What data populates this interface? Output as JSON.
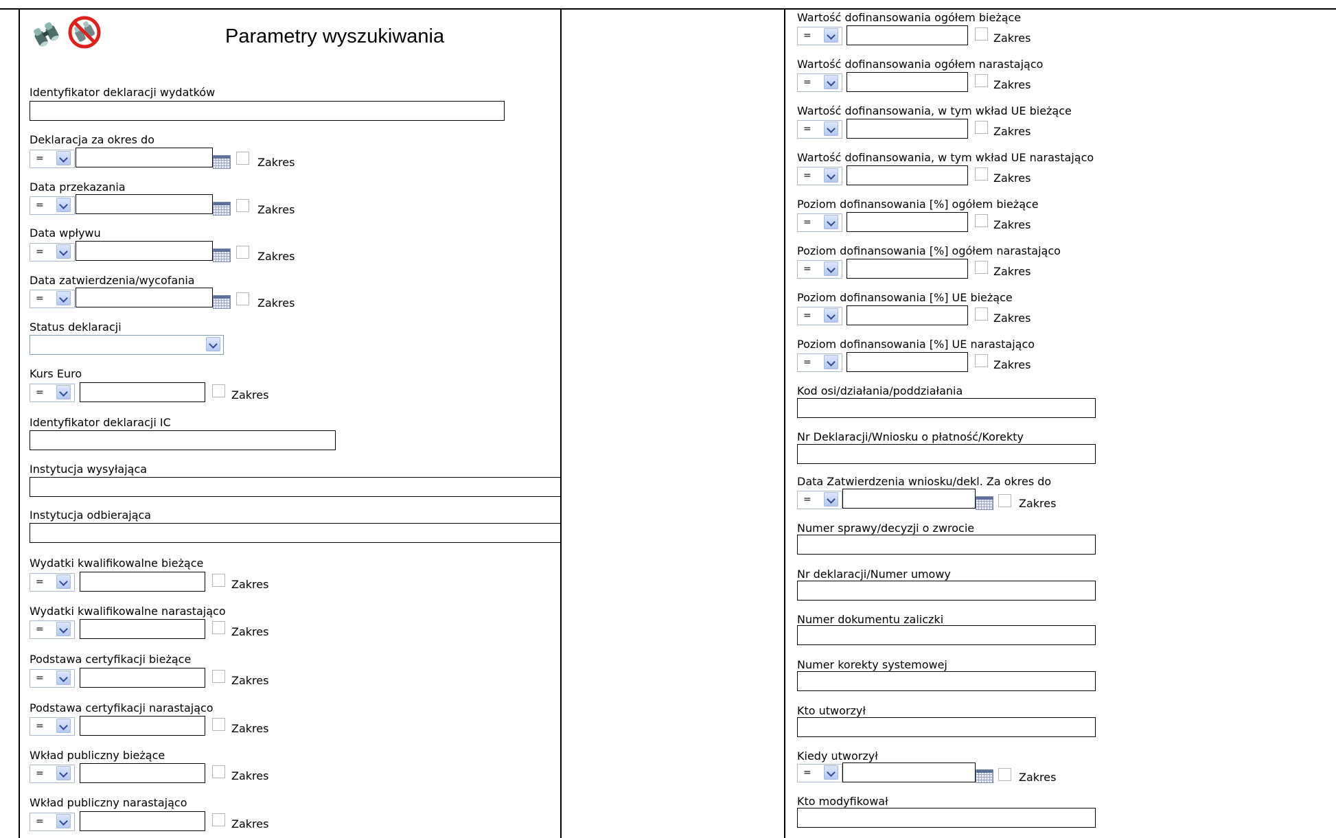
{
  "header": {
    "title": "Parametry wyszukiwania",
    "icons": [
      "binoculars-icon",
      "clear-search-icon"
    ]
  },
  "common": {
    "operator": "=",
    "range_label": "Zakres"
  },
  "left_fields": [
    {
      "label": "Identyfikator deklaracji wydatków",
      "type": "text"
    },
    {
      "label": "Deklaracja za okres do",
      "type": "date"
    },
    {
      "label": "Data przekazania",
      "type": "date"
    },
    {
      "label": "Data wpływu",
      "type": "date"
    },
    {
      "label": "Data zatwierdzenia/wycofania",
      "type": "date"
    },
    {
      "label": "Status deklaracji",
      "type": "select",
      "value": ""
    },
    {
      "label": "Kurs Euro",
      "type": "number"
    },
    {
      "label": "Identyfikator deklaracji IC",
      "type": "text"
    },
    {
      "label": "Instytucja wysyłająca",
      "type": "text"
    },
    {
      "label": "Instytucja odbierająca",
      "type": "text"
    },
    {
      "label": "Wydatki kwalifikowalne bieżące",
      "type": "number"
    },
    {
      "label": "Wydatki kwalifikowalne narastająco",
      "type": "number"
    },
    {
      "label": "Podstawa certyfikacji bieżące",
      "type": "number"
    },
    {
      "label": "Podstawa certyfikacji narastająco",
      "type": "number"
    },
    {
      "label": "Wkład publiczny bieżące",
      "type": "number"
    },
    {
      "label": "Wkład publiczny narastająco",
      "type": "number"
    }
  ],
  "right_fields": [
    {
      "label": "Wartość dofinansowania ogółem bieżące",
      "type": "number"
    },
    {
      "label": "Wartość dofinansowania ogółem narastająco",
      "type": "number"
    },
    {
      "label": "Wartość dofinansowania, w tym wkład UE bieżące",
      "type": "number"
    },
    {
      "label": "Wartość dofinansowania, w tym wkład UE narastająco",
      "type": "number"
    },
    {
      "label": "Poziom dofinansowania [%] ogółem bieżące",
      "type": "number"
    },
    {
      "label": "Poziom dofinansowania [%] ogółem narastająco",
      "type": "number"
    },
    {
      "label": "Poziom dofinansowania [%] UE bieżące",
      "type": "number"
    },
    {
      "label": "Poziom dofinansowania [%] UE narastająco",
      "type": "number"
    },
    {
      "label": "Kod osi/działania/poddziałania",
      "type": "text"
    },
    {
      "label": "Nr Deklaracji/Wniosku o płatność/Korekty",
      "type": "text"
    },
    {
      "label": "Data Zatwierdzenia wniosku/dekl. Za okres do",
      "type": "date"
    },
    {
      "label": "Numer sprawy/decyzji o zwrocie",
      "type": "text"
    },
    {
      "label": "Nr deklaracji/Numer umowy",
      "type": "text"
    },
    {
      "label": "Numer dokumentu zaliczki",
      "type": "text"
    },
    {
      "label": "Numer korekty systemowej",
      "type": "text"
    },
    {
      "label": "Kto utworzył",
      "type": "text"
    },
    {
      "label": "Kiedy utworzył",
      "type": "date"
    },
    {
      "label": "Kto modyfikował",
      "type": "text"
    }
  ]
}
